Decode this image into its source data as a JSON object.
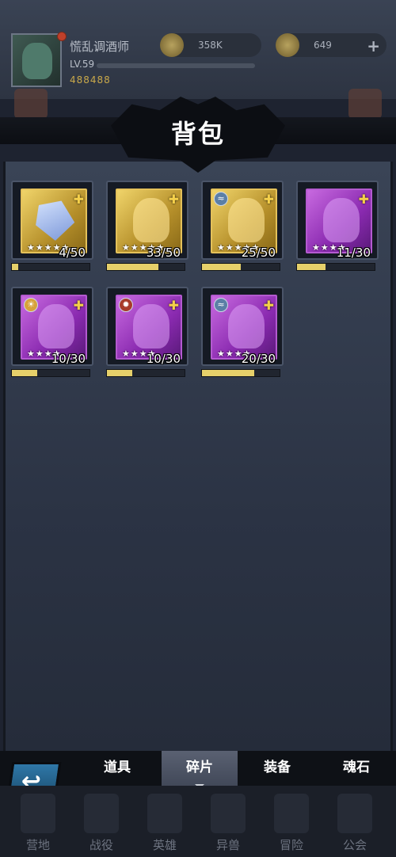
{
  "player": {
    "name": "慌乱调酒师",
    "level": "LV.59",
    "power": "488488",
    "currency_a": "358K",
    "currency_b": "649"
  },
  "panel": {
    "title": "背包"
  },
  "items": [
    {
      "type": "gold",
      "element": "",
      "count": "4/50",
      "progress": 0.08,
      "stars": "★★★★★",
      "art": "crystal"
    },
    {
      "type": "gold",
      "element": "",
      "count": "33/50",
      "progress": 0.66,
      "stars": "★★★★★",
      "art": "hero"
    },
    {
      "type": "gold",
      "element": "water",
      "count": "25/50",
      "progress": 0.5,
      "stars": "★★★★★",
      "art": "hero"
    },
    {
      "type": "purple",
      "element": "",
      "count": "11/30",
      "progress": 0.37,
      "stars": "★★★★",
      "art": "hero"
    },
    {
      "type": "purple",
      "element": "sun",
      "count": "10/30",
      "progress": 0.33,
      "stars": "★★★★",
      "art": "hero"
    },
    {
      "type": "purple",
      "element": "fire",
      "count": "10/30",
      "progress": 0.33,
      "stars": "★★★★",
      "art": "hero"
    },
    {
      "type": "purple",
      "element": "water",
      "count": "20/30",
      "progress": 0.67,
      "stars": "★★★★",
      "art": "hero"
    }
  ],
  "tabs": [
    {
      "label": "道具",
      "active": false
    },
    {
      "label": "碎片",
      "active": true
    },
    {
      "label": "装备",
      "active": false
    },
    {
      "label": "魂石",
      "active": false
    }
  ],
  "nav": [
    "营地",
    "战役",
    "英雄",
    "异兽",
    "冒险",
    "公会"
  ]
}
